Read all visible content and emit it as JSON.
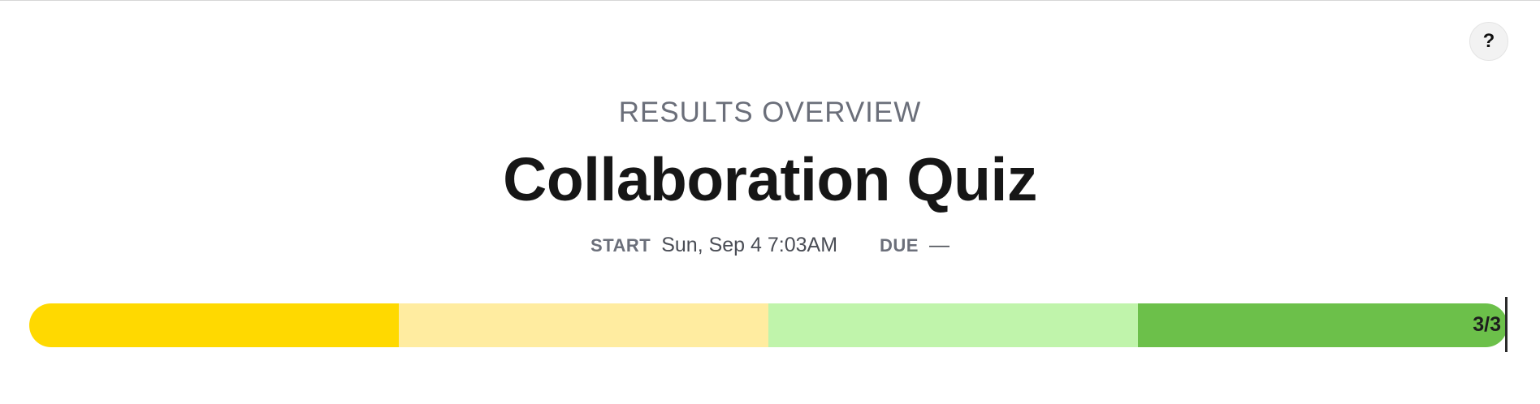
{
  "help": {
    "label": "?"
  },
  "header": {
    "eyebrow": "RESULTS OVERVIEW",
    "title": "Collaboration Quiz"
  },
  "meta": {
    "start_label": "START",
    "start_value": "Sun, Sep 4 7:03AM",
    "due_label": "DUE",
    "due_value": "—"
  },
  "progress": {
    "score_text": "3/3",
    "score": 3,
    "total": 3,
    "segments": [
      {
        "color": "#ffd900"
      },
      {
        "color": "#ffeca0"
      },
      {
        "color": "#c0f4ab"
      },
      {
        "color": "#6cc04a"
      }
    ]
  }
}
